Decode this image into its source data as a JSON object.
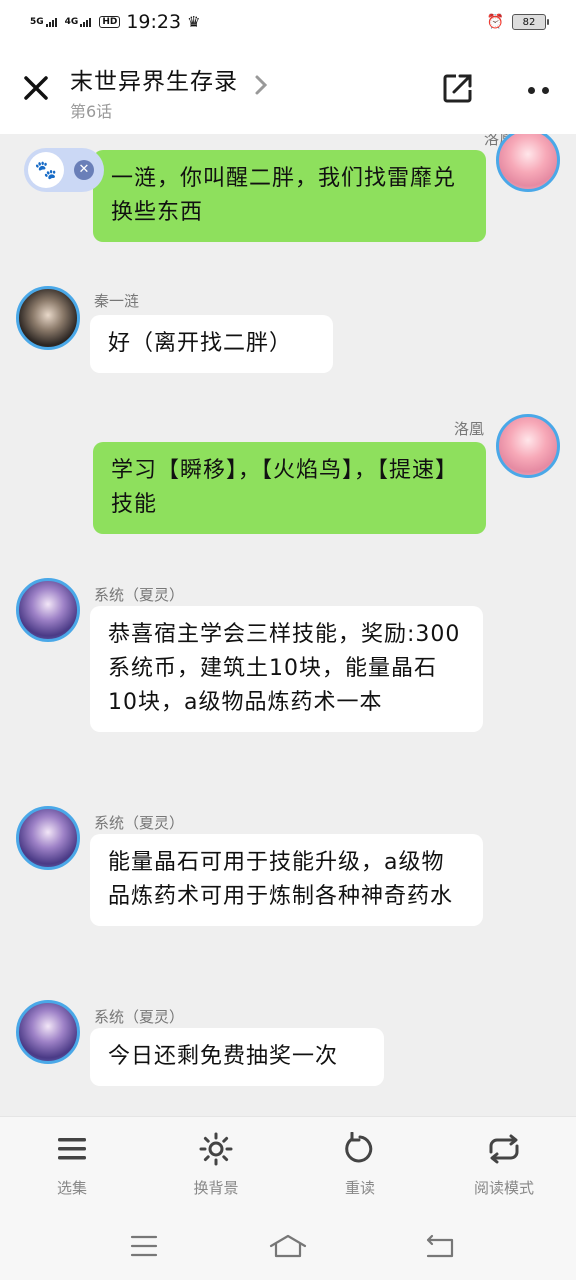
{
  "status_bar": {
    "net1": "5G",
    "net2": "4G",
    "hd": "HD",
    "time": "19:23",
    "battery": "82"
  },
  "header": {
    "title": "末世异界生存录",
    "subtitle": "第6话"
  },
  "messages": [
    {
      "side": "right",
      "name": "洛凰",
      "text": "一涟，你叫醒二胖，我们找雷靡兑换些东西"
    },
    {
      "side": "left",
      "name": "秦一涟",
      "text": "好（离开找二胖）"
    },
    {
      "side": "right",
      "name": "洛凰",
      "text": "学习【瞬移】，【火焰鸟】，【提速】技能"
    },
    {
      "side": "left",
      "name": "系统（夏灵）",
      "text": "恭喜宿主学会三样技能，奖励:300系统币，建筑土10块，能量晶石10块，a级物品炼药术一本"
    },
    {
      "side": "left",
      "name": "系统（夏灵）",
      "text": "能量晶石可用于技能升级，a级物品炼药术可用于炼制各种神奇药水"
    },
    {
      "side": "left",
      "name": "系统（夏灵）",
      "text": "今日还剩免费抽奖一次"
    }
  ],
  "toolbar": {
    "items": [
      {
        "label": "选集",
        "icon": "list-icon"
      },
      {
        "label": "换背景",
        "icon": "sun-icon"
      },
      {
        "label": "重读",
        "icon": "refresh-icon"
      },
      {
        "label": "阅读模式",
        "icon": "loop-icon"
      }
    ]
  },
  "colors": {
    "bubble_right": "#8ee05d",
    "bubble_left": "#ffffff",
    "avatar_border": "#4aa8e8"
  }
}
